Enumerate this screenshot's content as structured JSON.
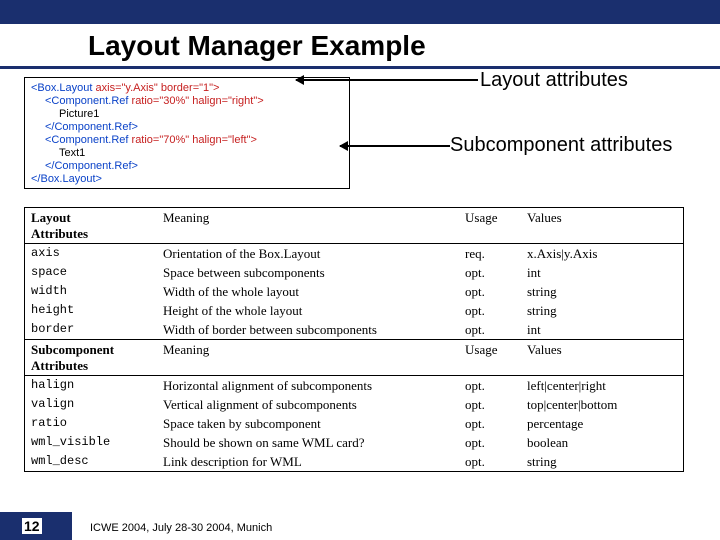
{
  "title": "Layout Manager Example",
  "annotations": {
    "layout_attrs": "Layout attributes",
    "subcomp_attrs": "Subcomponent attributes"
  },
  "code": {
    "l1a": "<Box.Layout",
    "l1b": " axis=\"y.Axis\" border=\"1\">",
    "l2a": "<Component.Ref",
    "l2b": " ratio=\"30%\" halign=\"right\">",
    "l3": "Picture1",
    "l4": "</Component.Ref>",
    "l5a": "<Component.Ref",
    "l5b": " ratio=\"70%\" halign=\"left\">",
    "l6": "Text1",
    "l7": "</Component.Ref>",
    "l8": "</Box.Layout>"
  },
  "table": {
    "hdr1": {
      "c1": "Layout\nAttributes",
      "c2": "Meaning",
      "c3": "Usage",
      "c4": "Values"
    },
    "rows1": [
      {
        "c1": "axis",
        "c2": "Orientation of the Box.Layout",
        "c3": "req.",
        "c4": "x.Axis|y.Axis"
      },
      {
        "c1": "space",
        "c2": "Space between subcomponents",
        "c3": "opt.",
        "c4": "int"
      },
      {
        "c1": "width",
        "c2": "Width of the whole layout",
        "c3": "opt.",
        "c4": "string"
      },
      {
        "c1": "height",
        "c2": "Height of the whole layout",
        "c3": "opt.",
        "c4": "string"
      },
      {
        "c1": "border",
        "c2": "Width of border between subcomponents",
        "c3": "opt.",
        "c4": "int"
      }
    ],
    "hdr2": {
      "c1": "Subcomponent\nAttributes",
      "c2": "Meaning",
      "c3": "Usage",
      "c4": "Values"
    },
    "rows2": [
      {
        "c1": "halign",
        "c2": "Horizontal alignment of subcomponents",
        "c3": "opt.",
        "c4": "left|center|right"
      },
      {
        "c1": "valign",
        "c2": "Vertical alignment of subcomponents",
        "c3": "opt.",
        "c4": "top|center|bottom"
      },
      {
        "c1": "ratio",
        "c2": "Space taken by subcomponent",
        "c3": "opt.",
        "c4": "percentage"
      },
      {
        "c1": "wml_visible",
        "c2": "Should be shown on same WML card?",
        "c3": "opt.",
        "c4": "boolean"
      },
      {
        "c1": "wml_desc",
        "c2": "Link description for WML",
        "c3": "opt.",
        "c4": "string"
      }
    ]
  },
  "footer": {
    "page": "12",
    "text": "ICWE 2004, July 28-30 2004, Munich"
  }
}
